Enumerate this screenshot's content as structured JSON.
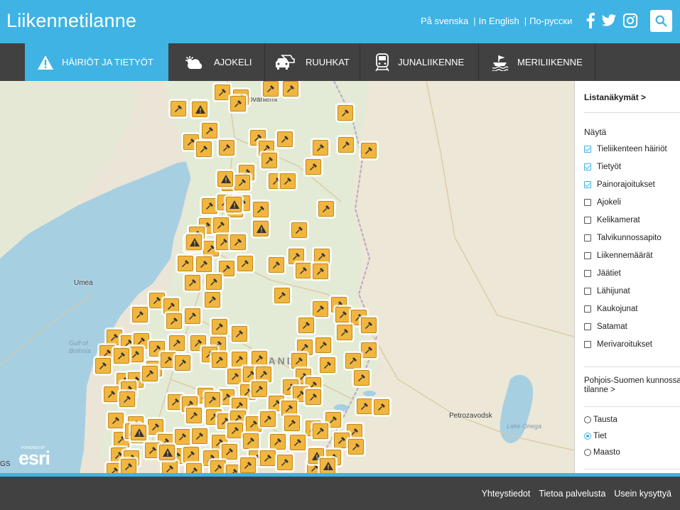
{
  "header": {
    "title": "Liikennetilanne",
    "languages": [
      "På svenska",
      "In English",
      "По-русски"
    ],
    "social": [
      "facebook-icon",
      "twitter-icon",
      "instagram-icon"
    ],
    "search_icon": "search-icon",
    "brand_color": "#3fb3e3"
  },
  "nav": {
    "tabs": [
      {
        "label": "HÄIRIÖT JA TIETYÖT",
        "icon": "warning-icon",
        "active": true
      },
      {
        "label": "AJOKELI",
        "icon": "weather-icon",
        "active": false
      },
      {
        "label": "RUUHKAT",
        "icon": "cars-icon",
        "active": false
      },
      {
        "label": "JUNALIIKENNE",
        "icon": "train-icon",
        "active": false
      },
      {
        "label": "MERILIIKENNE",
        "icon": "ship-icon",
        "active": false
      }
    ]
  },
  "map": {
    "labels": {
      "rovaniemi": "Rovaniemi",
      "umea": "Umea",
      "gulf": "Gulf of",
      "bothnia": "Bothnia",
      "finland": "LAND",
      "petrozavodsk": "Petrozavodsk",
      "lake_onega": "Lake Onega",
      "esri": "esri",
      "powered_by": "POWERED BY",
      "gs": "GS"
    },
    "marker_icon": "roadwork-icon",
    "warning_marker_icon": "warning-marker-icon"
  },
  "sidebar": {
    "list_views": "Listanäkymät >",
    "show_title": "Näytä",
    "layers": [
      {
        "label": "Tieliikenteen häiriöt",
        "checked": true
      },
      {
        "label": "Tietyöt",
        "checked": true
      },
      {
        "label": "Painorajoitukset",
        "checked": true
      },
      {
        "label": "Ajokeli",
        "checked": false
      },
      {
        "label": "Kelikamerat",
        "checked": false
      },
      {
        "label": "Talvikunnossapito",
        "checked": false
      },
      {
        "label": "Liikennemäärät",
        "checked": false
      },
      {
        "label": "Jäätiet",
        "checked": false
      },
      {
        "label": "Lähijunat",
        "checked": false
      },
      {
        "label": "Kaukojunat",
        "checked": false
      },
      {
        "label": "Satamat",
        "checked": false
      },
      {
        "label": "Merivaroitukset",
        "checked": false
      }
    ],
    "region_line1": "Pohjois-Suomen kunnossa",
    "region_line2": "tilanne >",
    "basemaps": [
      {
        "label": "Tausta",
        "selected": false
      },
      {
        "label": "Tiet",
        "selected": true
      },
      {
        "label": "Maasto",
        "selected": false
      }
    ]
  },
  "footer": {
    "links": [
      "Yhteystiedot",
      "Tietoa palvelusta",
      "Usein kysyttyä"
    ]
  }
}
